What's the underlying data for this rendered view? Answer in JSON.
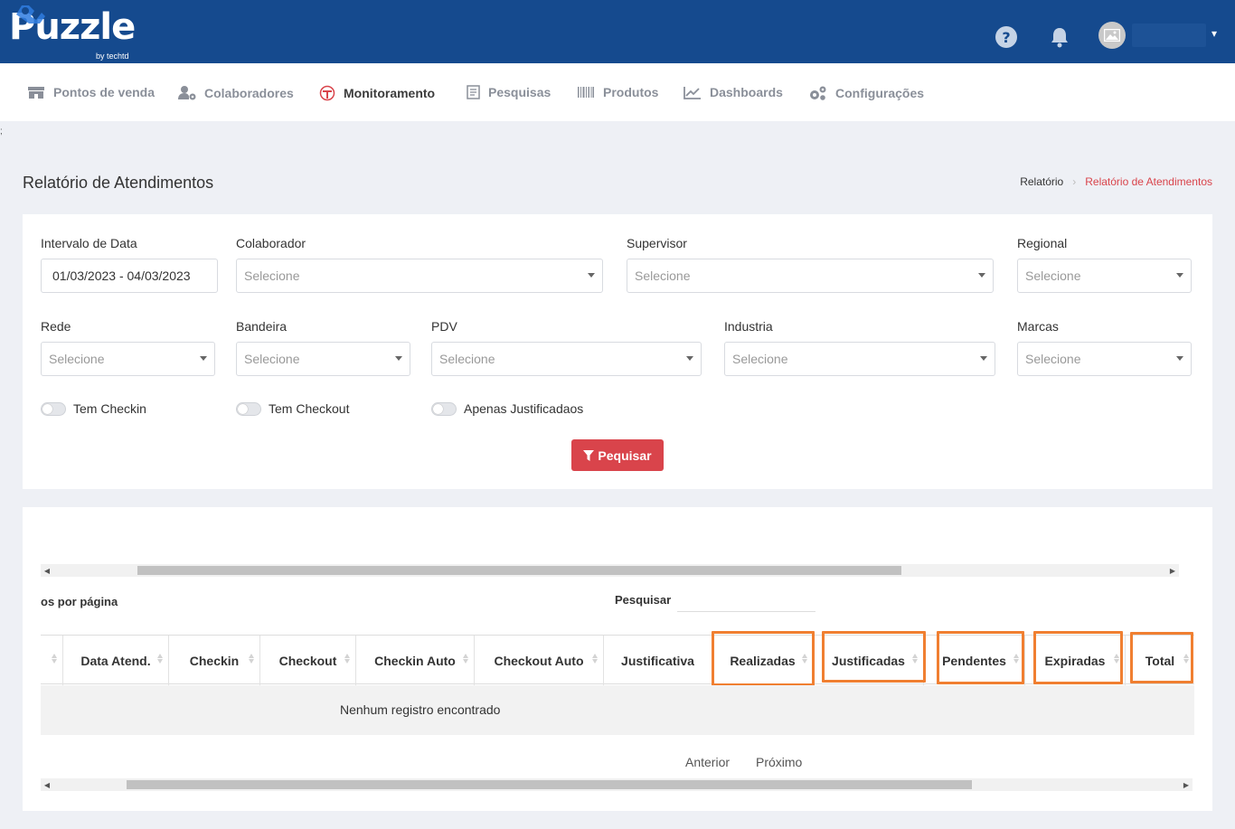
{
  "header": {
    "logo_text": "Puzzle",
    "logo_sub": "by techtd",
    "icons": [
      "help-icon",
      "bell-icon",
      "avatar-image-icon",
      "chevron-down-icon"
    ],
    "colors": {
      "topbar": "#154a8e",
      "accent": "#d9444b",
      "highlight": "#f07f31"
    }
  },
  "nav": {
    "items": [
      {
        "label": "Pontos de venda",
        "icon": "store-icon"
      },
      {
        "label": "Colaboradores",
        "icon": "user-gear-icon"
      },
      {
        "label": "Monitoramento",
        "icon": "monitoring-icon",
        "active": true
      },
      {
        "label": "Pesquisas",
        "icon": "survey-icon"
      },
      {
        "label": "Produtos",
        "icon": "barcode-icon"
      },
      {
        "label": "Dashboards",
        "icon": "chart-line-icon"
      },
      {
        "label": "Configurações",
        "icon": "gears-icon"
      }
    ]
  },
  "stray_char": ";",
  "page": {
    "title": "Relatório de Atendimentos",
    "breadcrumb": [
      "Relatório",
      "Relatório de Atendimentos"
    ],
    "breadcrumb_sep": "›"
  },
  "filters": {
    "date_label": "Intervalo de Data",
    "date_value": "01/03/2023 - 04/03/2023",
    "colaborador_label": "Colaborador",
    "supervisor_label": "Supervisor",
    "regional_label": "Regional",
    "rede_label": "Rede",
    "bandeira_label": "Bandeira",
    "pdv_label": "PDV",
    "industria_label": "Industria",
    "marcas_label": "Marcas",
    "placeholder": "Selecione",
    "toggle_checkin": "Tem Checkin",
    "toggle_checkout": "Tem Checkout",
    "toggle_justificados": "Apenas Justificadaos",
    "search_button": "Pequisar"
  },
  "table": {
    "per_page_label": "os por página",
    "search_label": "Pesquisar",
    "columns": [
      "Data Atend.",
      "Checkin",
      "Checkout",
      "Checkin Auto",
      "Checkout Auto",
      "Justificativa",
      "Realizadas",
      "Justificadas",
      "Pendentes",
      "Expiradas",
      "Total"
    ],
    "highlighted_columns": [
      "Realizadas",
      "Justificadas",
      "Pendentes",
      "Expiradas",
      "Total"
    ],
    "empty_message": "Nenhum registro encontrado",
    "prev_label": "Anterior",
    "next_label": "Próximo",
    "top_scroll_position": 0.24,
    "bottom_scroll_position": 0.26
  }
}
